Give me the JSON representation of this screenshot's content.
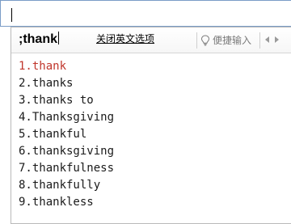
{
  "input": {
    "value": ""
  },
  "ime": {
    "composition": ";thank",
    "close_english_option": "关闭英文选项",
    "quick_input_label": "便捷输入",
    "quick_input_icon": "lightbulb-icon",
    "prev_icon": "triangle-left-icon",
    "next_icon": "triangle-right-icon",
    "selected_color": "#c0362c",
    "candidates": [
      "1.thank",
      "2.thanks",
      "3.thanks to",
      "4.Thanksgiving",
      "5.thankful",
      "6.thanksgiving",
      "7.thankfulness",
      "8.thankfully",
      "9.thankless"
    ]
  }
}
